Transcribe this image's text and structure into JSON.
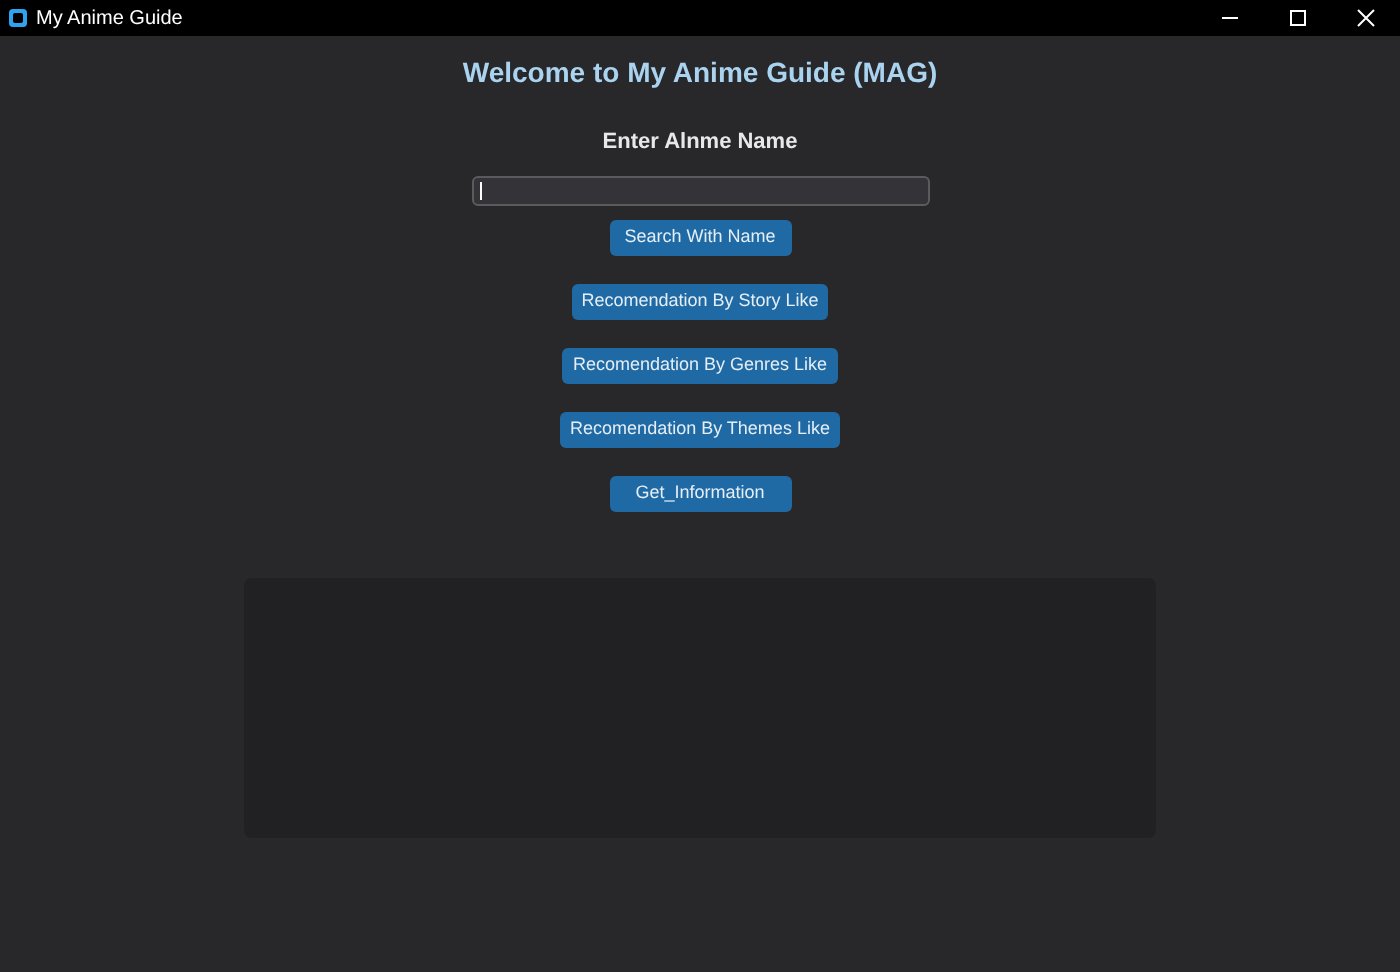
{
  "window": {
    "title": "My Anime Guide"
  },
  "heading": "Welcome to My Anime Guide (MAG)",
  "search": {
    "label": "Enter Alnme Name"
  },
  "buttons": [
    "Search With Name",
    "Recomendation By Story Like",
    "Recomendation By Genres Like",
    "Recomendation By Themes Like",
    "Get_Information"
  ]
}
